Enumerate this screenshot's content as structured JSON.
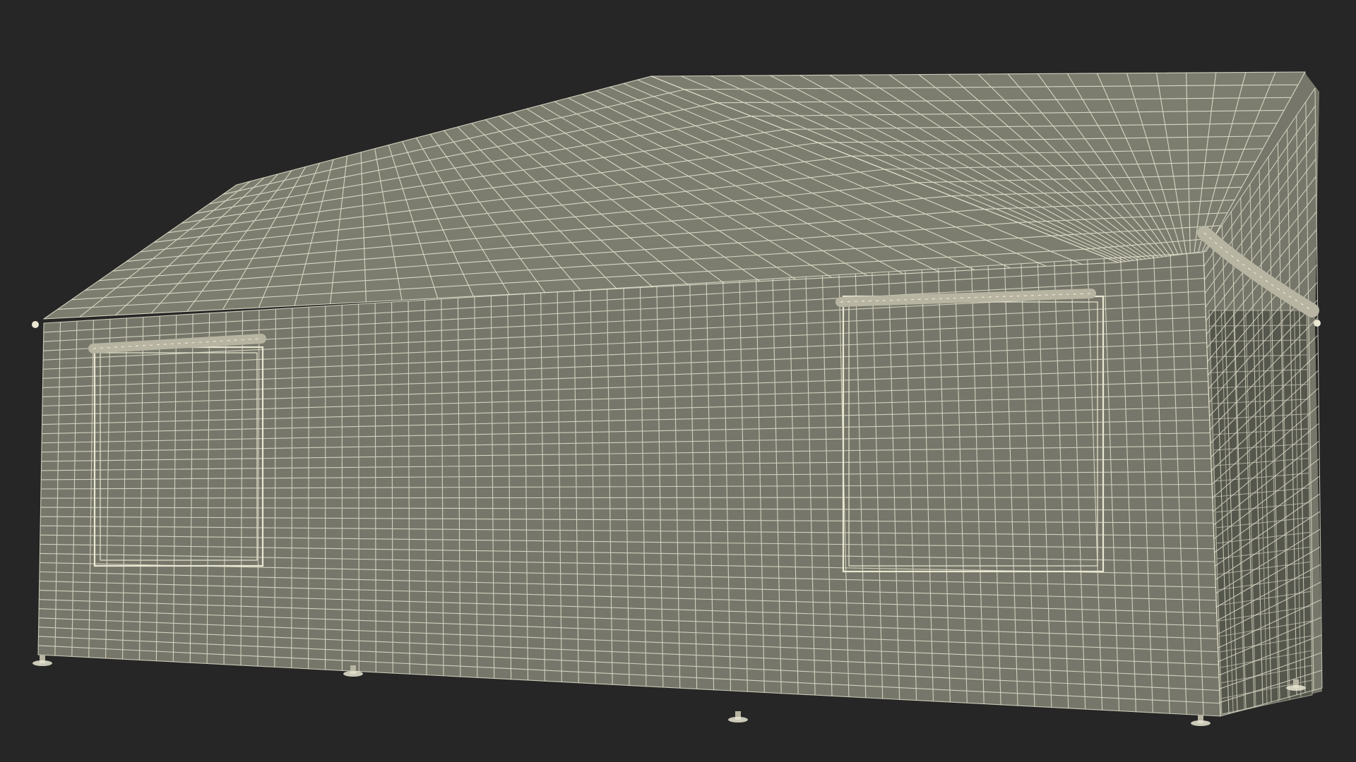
{
  "scene": {
    "subject": "wireframe-tent-model",
    "colors": {
      "background": "#262626",
      "surface": "#76776a",
      "surface_roof": "#7c7d6f",
      "surface_inner": "#55574d",
      "wire": "#e9e6d2",
      "rolled_flap": "#b7b4a2"
    }
  }
}
